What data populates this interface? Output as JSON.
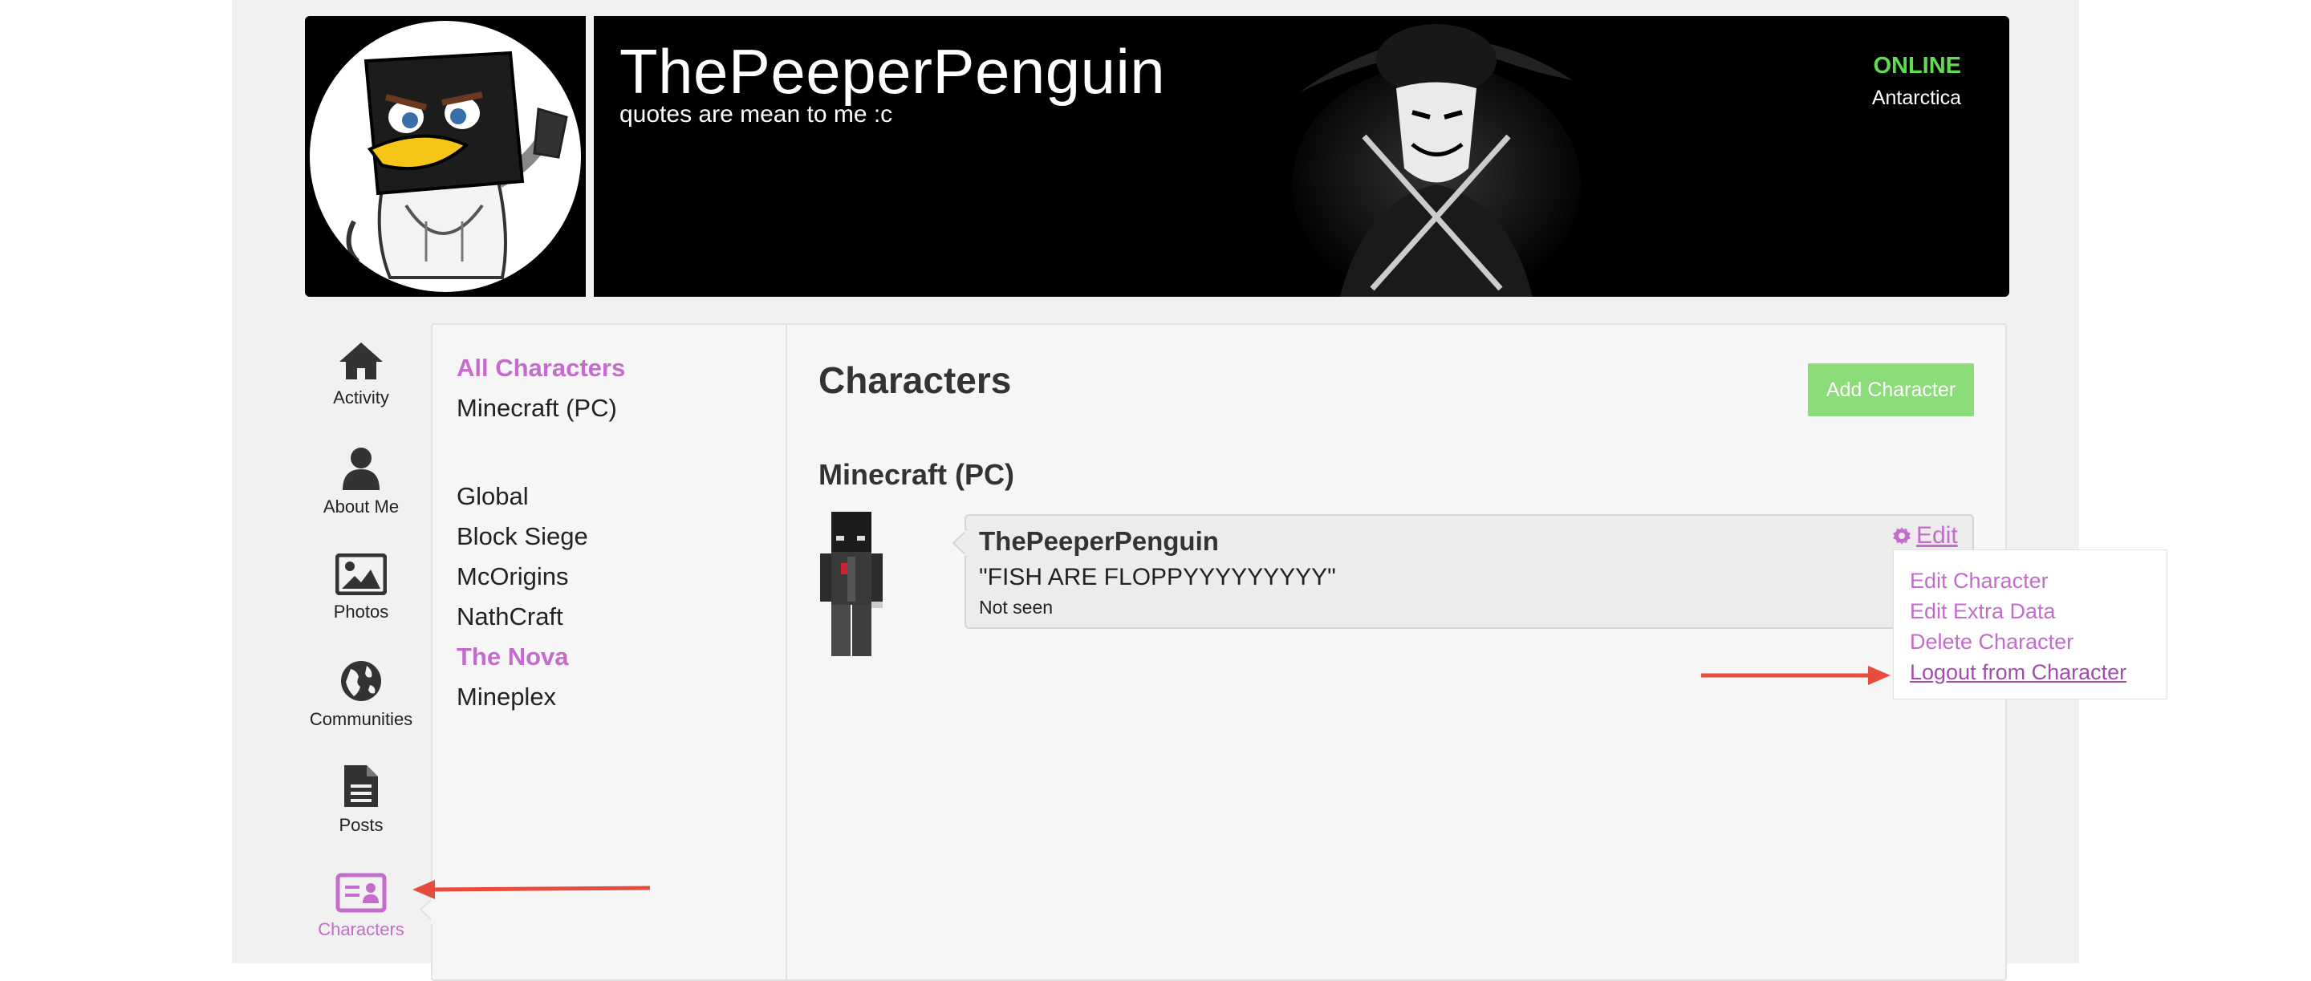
{
  "profile": {
    "username": "ThePeeperPenguin",
    "tagline": "quotes are mean to me :c",
    "status": "ONLINE",
    "location": "Antarctica"
  },
  "nav": {
    "items": [
      {
        "label": "Activity",
        "icon": "home-icon"
      },
      {
        "label": "About Me",
        "icon": "user-icon"
      },
      {
        "label": "Photos",
        "icon": "image-icon"
      },
      {
        "label": "Communities",
        "icon": "globe-icon"
      },
      {
        "label": "Posts",
        "icon": "document-icon"
      },
      {
        "label": "Characters",
        "icon": "id-card-icon",
        "active": true
      }
    ]
  },
  "filters": {
    "primary": [
      "All Characters",
      "Minecraft (PC)"
    ],
    "communities": [
      "Global",
      "Block Siege",
      "McOrigins",
      "NathCraft",
      "The Nova",
      "Mineplex"
    ]
  },
  "content": {
    "title": "Characters",
    "add_button": "Add Character",
    "group_title": "Minecraft (PC)"
  },
  "character": {
    "name": "ThePeeperPenguin",
    "quote": "\"FISH ARE FLOPPYYYYYYYYY\"",
    "last_seen": "Not seen",
    "edit_label": "Edit"
  },
  "edit_menu": {
    "items": [
      "Edit Character",
      "Edit Extra Data",
      "Delete Character",
      "Logout from Character"
    ]
  },
  "colors": {
    "accent": "#c36ccc",
    "online": "#5ddd4f",
    "add_button": "#8cdc7a",
    "annotation_arrow": "#e74c3c"
  }
}
